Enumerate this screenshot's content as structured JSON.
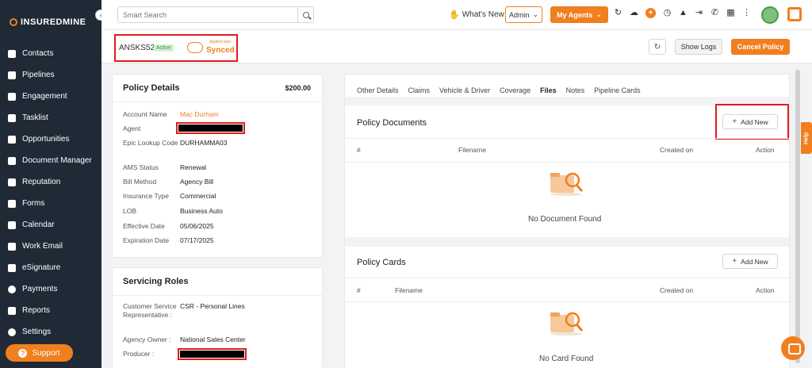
{
  "sidebar": {
    "logo": "INSUREDMINE",
    "collapse_icon": "‹",
    "items": [
      {
        "label": "Contacts",
        "icon": "contacts-icon"
      },
      {
        "label": "Pipelines",
        "icon": "pipelines-icon"
      },
      {
        "label": "Engagement",
        "icon": "engagement-icon"
      },
      {
        "label": "Tasklist",
        "icon": "tasklist-icon"
      },
      {
        "label": "Opportunities",
        "icon": "opportunities-icon"
      },
      {
        "label": "Document Manager",
        "icon": "folder-icon"
      },
      {
        "label": "Reputation",
        "icon": "reputation-icon"
      },
      {
        "label": "Forms",
        "icon": "forms-icon"
      },
      {
        "label": "Calendar",
        "icon": "calendar-icon"
      },
      {
        "label": "Work Email",
        "icon": "mail-icon"
      },
      {
        "label": "eSignature",
        "icon": "signature-icon"
      },
      {
        "label": "Payments",
        "icon": "dollar-icon"
      },
      {
        "label": "Reports",
        "icon": "reports-icon"
      },
      {
        "label": "Settings",
        "icon": "gear-icon"
      }
    ],
    "support_label": "Support"
  },
  "topbar": {
    "search_placeholder": "Smart Search",
    "whats_new": "What's New",
    "admin_label": "Admin",
    "agents_label": "My Agents",
    "chevron": "⌄"
  },
  "header": {
    "policy_id": "ANSKS521",
    "status_badge": "Active",
    "sync_small": "Applied Epic",
    "sync_status": "Synced",
    "refresh_icon": "↻",
    "show_logs": "Show Logs",
    "cancel_policy": "Cancel Policy"
  },
  "policy_details": {
    "title": "Policy Details",
    "price": "$200.00",
    "rows": [
      {
        "label": "Account Name",
        "value": "Mac Durham"
      },
      {
        "label": "Agent",
        "value": ""
      },
      {
        "label": "Epic Lookup Code",
        "value": "DURHAMMA03"
      },
      {
        "label": "AMS Status",
        "value": "Renewal"
      },
      {
        "label": "Bill Method",
        "value": "Agency Bill"
      },
      {
        "label": "Insurance Type",
        "value": "Commercial"
      },
      {
        "label": "LOB",
        "value": "Business Auto"
      },
      {
        "label": "Effective Date",
        "value": "05/06/2025"
      },
      {
        "label": "Expiration Date",
        "value": "07/17/2025"
      }
    ]
  },
  "servicing_roles": {
    "title": "Servicing Roles",
    "rows": [
      {
        "label": "Customer Service Representative :",
        "value": "CSR - Personal Lines"
      },
      {
        "label": "Agency Owner :",
        "value": "National Sales Center"
      },
      {
        "label": "Producer :",
        "value": ""
      }
    ]
  },
  "tabs": [
    "Other Details",
    "Claims",
    "Vehicle & Driver",
    "Coverage",
    "Files",
    "Notes",
    "Pipeline Cards"
  ],
  "active_tab": "Files",
  "policy_documents": {
    "title": "Policy Documents",
    "add_new": "Add New",
    "columns": [
      "#",
      "Filename",
      "Created on",
      "Action"
    ],
    "empty_text": "No Document Found"
  },
  "policy_cards": {
    "title": "Policy Cards",
    "add_new": "Add New",
    "columns": [
      "#",
      "Filename",
      "Created on",
      "Action"
    ],
    "empty_text": "No Card Found"
  },
  "help_label": "Help",
  "colors": {
    "accent": "#f07f1f",
    "sidebar": "#1f2a36",
    "redline": "#e21b1b"
  }
}
